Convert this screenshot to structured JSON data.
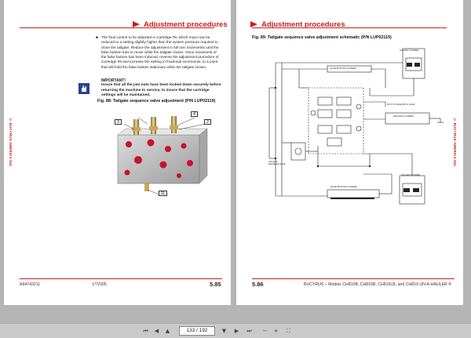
{
  "left_page": {
    "header_title": "Adjustment procedures",
    "side_text": "© BUCYRUS AMERICA INC.",
    "paragraph": "The final control to be adjusted is Cartridge #9, which must now be reduced to a setting slightly higher than the system pressure required to close the tailgate. Reduce the adjustment in full turn increments until the false bottom tries to move while the tailgate closes. Once movement of the false bottom has been induced, reverse the adjustment procedure of Cartridge #9 and increase the setting in fractional increments, to a point that will hold the false bottom stationary while the tailgate closes.",
    "important_title": "IMPORTANT!",
    "important_text": "Insure that all the jam nuts have been locked down securely before returning the machine to service, to insure that the cartridge settings will be maintained.",
    "figure_caption": "Fig. 88: Tailgate sequence valve adjustment (P/N LUP02119)",
    "callouts": [
      "3",
      "4",
      "2",
      "11"
    ],
    "footer_left": "A94743211",
    "footer_mid": "VTV005",
    "page_number": "5.85"
  },
  "right_page": {
    "header_title": "Adjustment procedures",
    "side_text": "© BUCYRUS AMERICA INC.",
    "figure_caption": "Fig. 89: Tailgate sequence valve adjustment schematic (P/N LUP02119)",
    "schematic_labels": {
      "false_bottom_cylinder_top": "FALSE BOTTOM CYLINDER",
      "tailgate_cylinder_top": "TAILGATE CYLINDER",
      "pilot_to_slide": "PILOT TO SLIDE SPOOL VALVE",
      "ejector_cylinder": "EJECTOR CYLINDER",
      "tailgate_sequence_valve": "TAILGATE SEQUENCE VALVE",
      "false_bottom_cylinder_bottom": "FALSE BOTTOM CYLINDER",
      "tailgate_cylinder_bottom": "TAILGATE CYLINDER"
    },
    "page_number": "5.86",
    "footer_text": "BUCYRUS – Models CH810B, CH816B, CH816LB, and CH819 UN-A-HAULER ®"
  },
  "toolbar": {
    "page_display": "133 / 192"
  }
}
